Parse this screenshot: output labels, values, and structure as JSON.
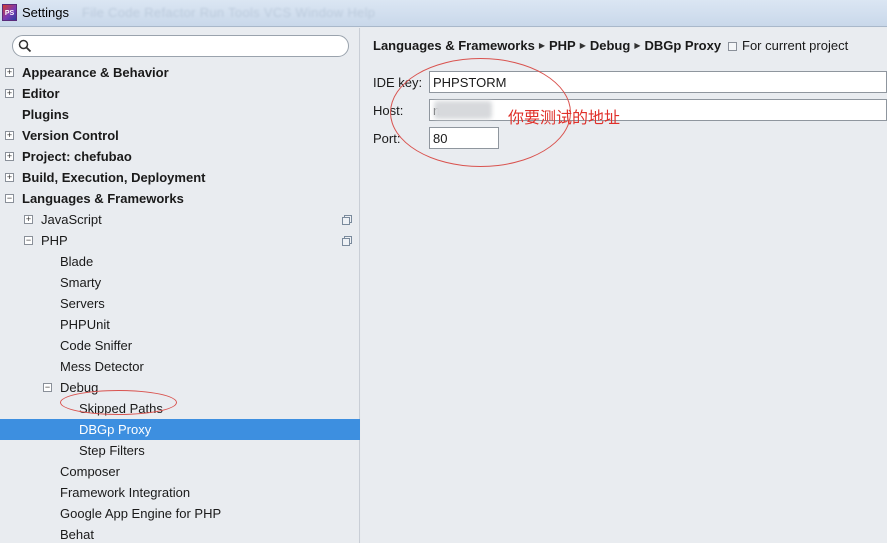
{
  "window": {
    "title": "Settings",
    "app_icon_text": "PS",
    "ghost_menu": "File  Code  Refactor  Run  Tools  VCS  Window  Help"
  },
  "search": {
    "value": "",
    "placeholder": ""
  },
  "tree": {
    "items": [
      {
        "label": "Appearance & Behavior",
        "expander": "+"
      },
      {
        "label": "Editor",
        "expander": "+"
      },
      {
        "label": "Plugins",
        "expander": ""
      },
      {
        "label": "Version Control",
        "expander": "+"
      },
      {
        "label": "Project: chefubao",
        "expander": "+"
      },
      {
        "label": "Build, Execution, Deployment",
        "expander": "+"
      },
      {
        "label": "Languages & Frameworks",
        "expander": "−"
      },
      {
        "label": "JavaScript",
        "expander": "+"
      },
      {
        "label": "PHP",
        "expander": "−"
      },
      {
        "label": "Blade",
        "expander": ""
      },
      {
        "label": "Smarty",
        "expander": ""
      },
      {
        "label": "Servers",
        "expander": ""
      },
      {
        "label": "PHPUnit",
        "expander": ""
      },
      {
        "label": "Code Sniffer",
        "expander": ""
      },
      {
        "label": "Mess Detector",
        "expander": ""
      },
      {
        "label": "Debug",
        "expander": "−"
      },
      {
        "label": "Skipped Paths",
        "expander": ""
      },
      {
        "label": "DBGp Proxy",
        "expander": ""
      },
      {
        "label": "Step Filters",
        "expander": ""
      },
      {
        "label": "Composer",
        "expander": ""
      },
      {
        "label": "Framework Integration",
        "expander": ""
      },
      {
        "label": "Google App Engine for PHP",
        "expander": ""
      },
      {
        "label": "Behat",
        "expander": ""
      }
    ]
  },
  "breadcrumb": {
    "items": [
      "Languages & Frameworks",
      "PHP",
      "Debug",
      "DBGp Proxy"
    ],
    "separator": "▶"
  },
  "scope": {
    "label": "For current project"
  },
  "form": {
    "ide_key_label": "IDE key:",
    "ide_key_value": "PHPSTORM",
    "host_label": "Host:",
    "host_value": "n",
    "port_label": "Port:",
    "port_value": "80"
  },
  "annotation": {
    "text": "你要测试的地址",
    "color": "#e0302a"
  },
  "colors": {
    "selection": "#3d8fe0",
    "panel_bg": "#e9ecf0"
  }
}
